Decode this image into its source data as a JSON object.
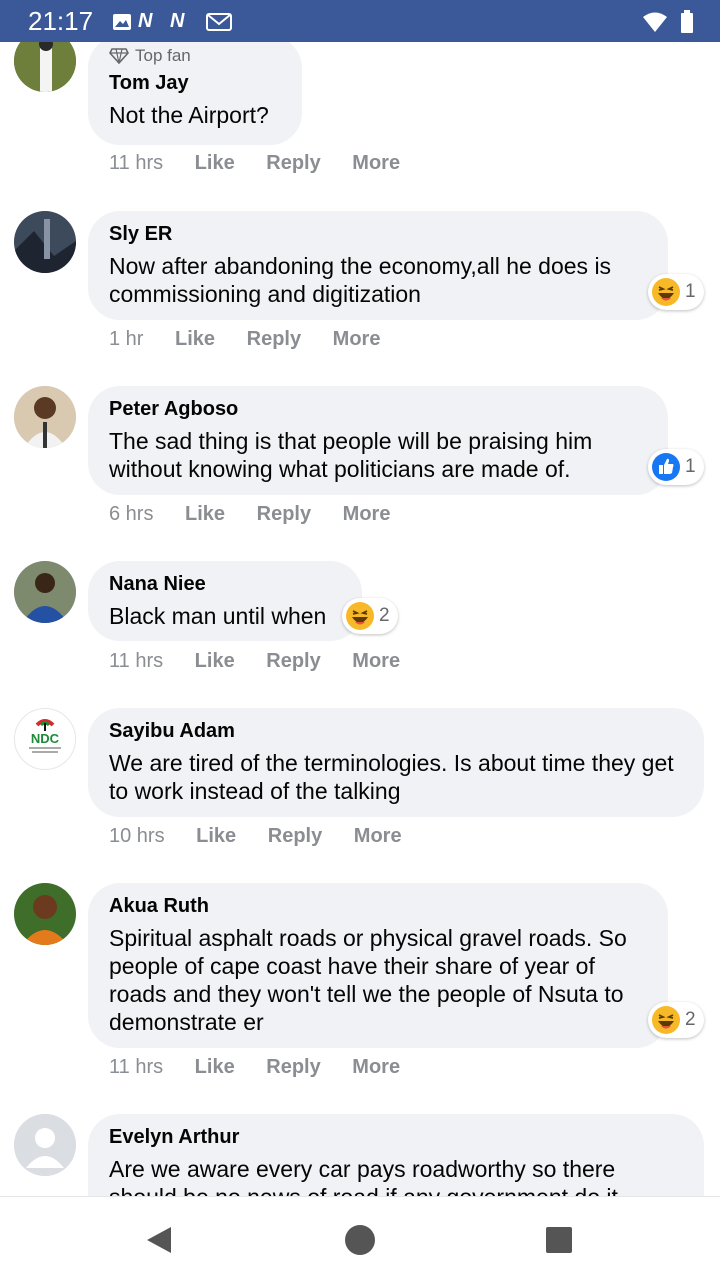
{
  "status_bar": {
    "time": "21:17",
    "icons": "N N"
  },
  "comments": [
    {
      "top_fan": "Top fan",
      "name": "Tom Jay",
      "text": "Not the Airport?",
      "time": "11 hrs",
      "like": "Like",
      "reply": "Reply",
      "more": "More"
    },
    {
      "name": "Sly ER",
      "text": "Now after abandoning the economy,all he does is commissioning and digitization",
      "time": "1 hr",
      "like": "Like",
      "reply": "Reply",
      "more": "More",
      "reaction_count": "1",
      "reaction": "haha"
    },
    {
      "name": "Peter Agboso",
      "text": "The sad thing is that people will be praising him without knowing what politicians are made of.",
      "time": "6 hrs",
      "like": "Like",
      "reply": "Reply",
      "more": "More",
      "reaction_count": "1",
      "reaction": "like"
    },
    {
      "name": "Nana Niee",
      "text": "Black man until when",
      "time": "11 hrs",
      "like": "Like",
      "reply": "Reply",
      "more": "More",
      "reaction_count": "2",
      "reaction": "haha"
    },
    {
      "name": "Sayibu Adam",
      "text": "We are tired of the terminologies. Is about time they get to work instead of the talking",
      "time": "10 hrs",
      "like": "Like",
      "reply": "Reply",
      "more": "More",
      "avatar_text": "NDC"
    },
    {
      "name": "Akua Ruth",
      "text": "Spiritual asphalt roads or physical gravel roads. So people of cape coast have their share of year of roads and they won't tell we the people of Nsuta to demonstrate er",
      "time": "11 hrs",
      "like": "Like",
      "reply": "Reply",
      "more": "More",
      "reaction_count": "2",
      "reaction": "haha"
    },
    {
      "name": "Evelyn Arthur",
      "text": "Are we aware every car pays roadworthy so there should be no news of road if any government do it"
    }
  ],
  "colors": {
    "header": "#3b5998",
    "bubble": "#f0f2f5",
    "meta": "#8a8d91",
    "like_blue": "#1877f2",
    "haha_yellow": "#f7b928"
  }
}
